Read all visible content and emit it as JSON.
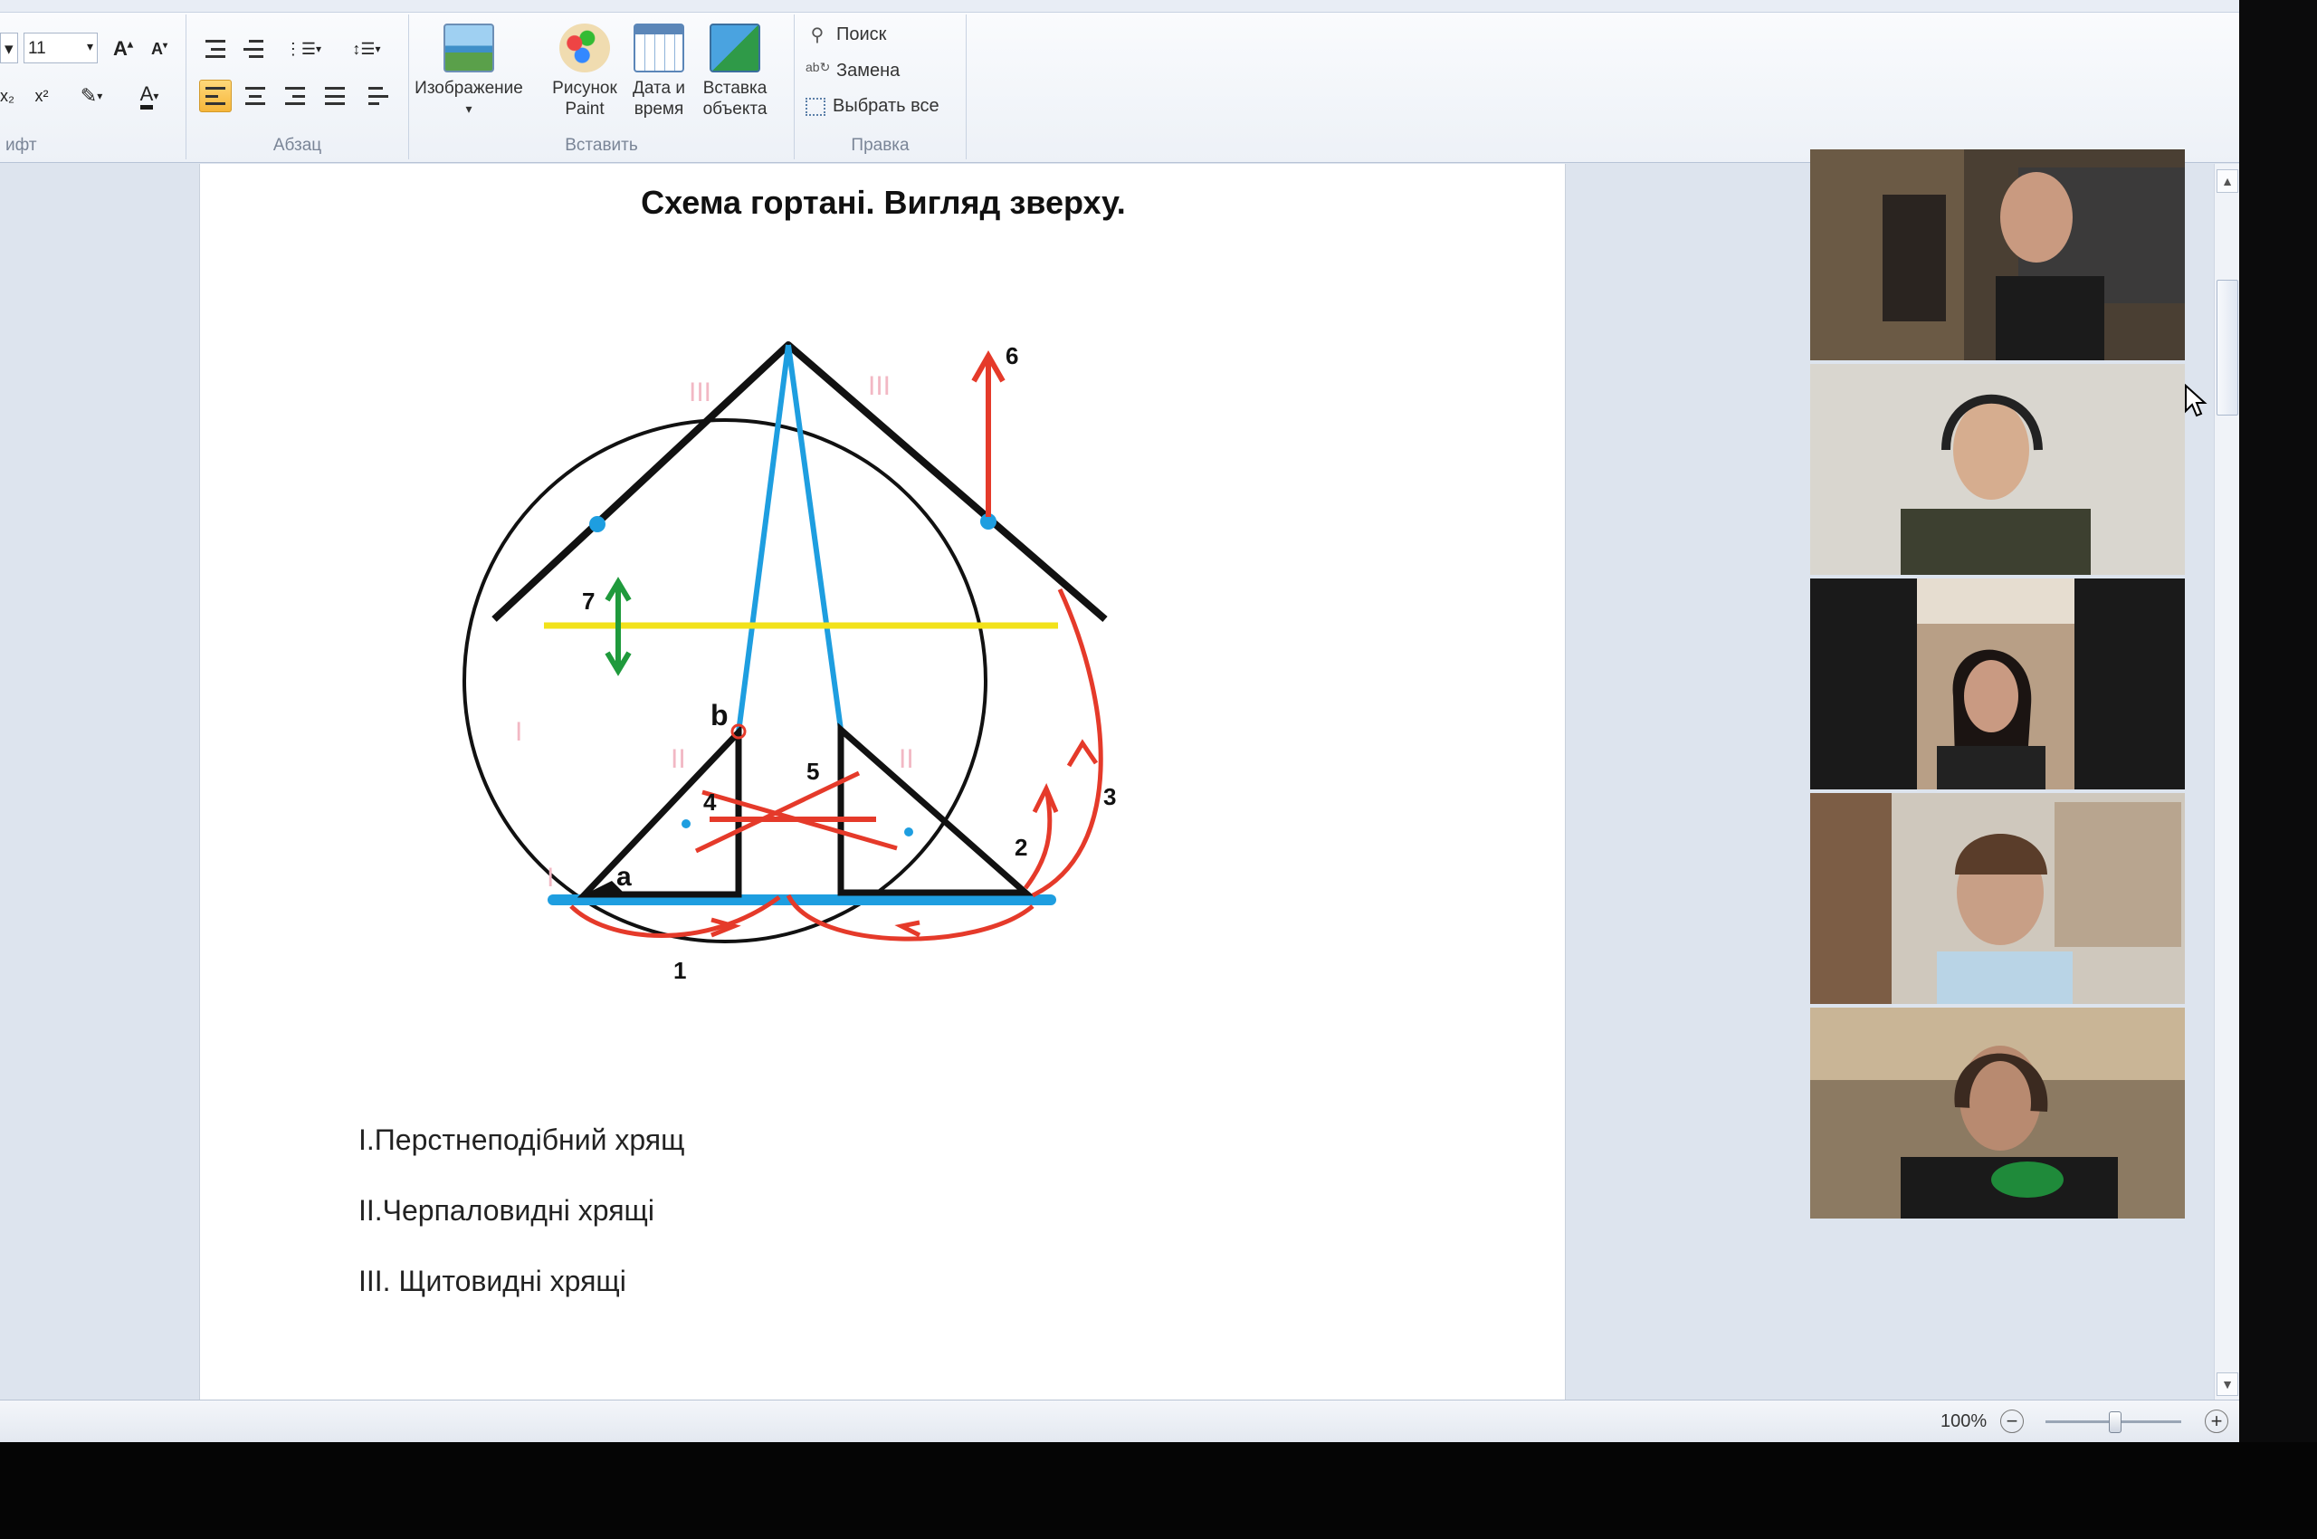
{
  "ribbon": {
    "font_group_label": "ифт",
    "font_size": "11",
    "paragraph_group_label": "Абзац",
    "insert_group_label": "Вставить",
    "insert_buttons": [
      {
        "line1": "Изображение",
        "line2": "▾"
      },
      {
        "line1": "Рисунок",
        "line2": "Paint"
      },
      {
        "line1": "Дата и",
        "line2": "время"
      },
      {
        "line1": "Вставка",
        "line2": "объекта"
      }
    ],
    "edit_group_label": "Правка",
    "edit_buttons": [
      "Поиск",
      "Замена",
      "Выбрать все"
    ]
  },
  "document": {
    "title": "Схема гортані. Вигляд зверху.",
    "diagram_labels": {
      "n1": "1",
      "n2": "2",
      "n3": "3",
      "n4": "4",
      "n5": "5",
      "n6": "6",
      "n7": "7",
      "a": "a",
      "b": "b",
      "roman_I": "I",
      "roman_II": "II",
      "roman_III": "III"
    },
    "legend": [
      "I.Перстнеподібний хрящ",
      "II.Черпаловидні хрящі",
      "III. Щитовидні хрящі"
    ]
  },
  "statusbar": {
    "zoom": "100%",
    "zoom_out": "−",
    "zoom_in": "+"
  },
  "colors": {
    "black": "#111111",
    "blue": "#1e9ee0",
    "red": "#e53a2a",
    "yellow": "#f2e21a",
    "green": "#1f9a3c",
    "pink": "#f2b8c4",
    "ribbon_active": "#f6b63a"
  }
}
